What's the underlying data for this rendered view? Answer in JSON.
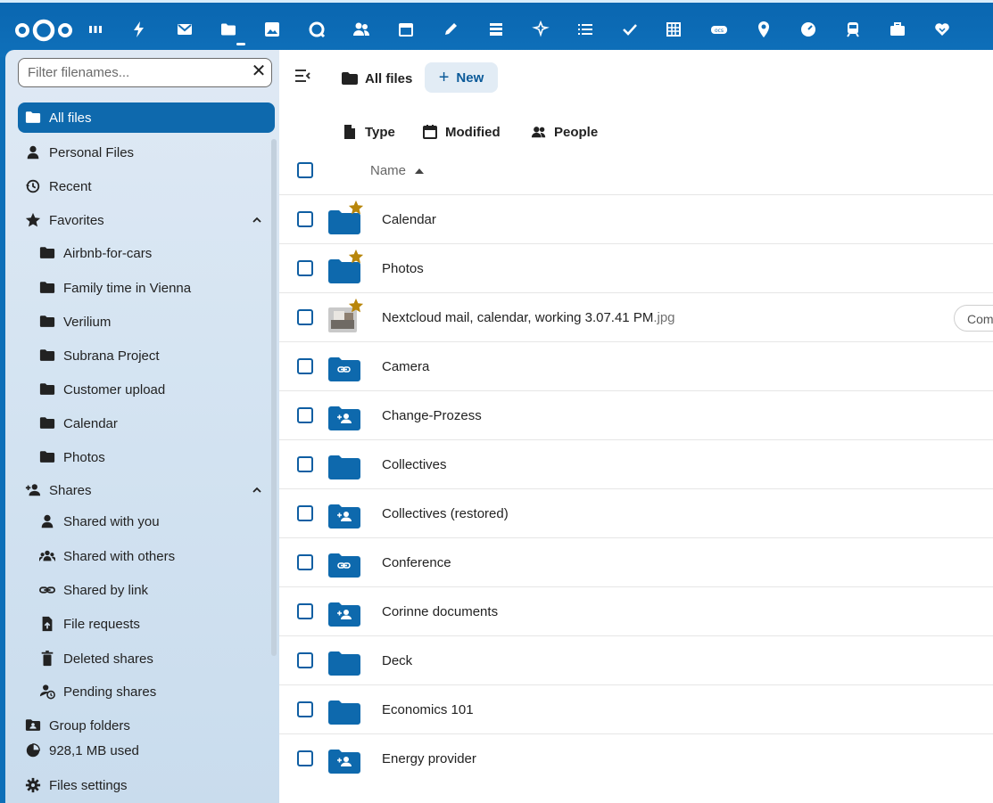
{
  "topbar": {
    "apps": [
      "dashboard-icon",
      "activity-icon",
      "mail-icon",
      "files-icon",
      "photos-icon",
      "talk-icon",
      "contacts-icon",
      "calendar-icon",
      "notes-icon",
      "deck-icon",
      "sparkle-icon",
      "tasks-list-icon",
      "checkmark-icon",
      "tables-icon",
      "ocs-icon",
      "maps-icon",
      "speedometer-icon",
      "train-icon",
      "briefcase-icon",
      "heart-hand-icon"
    ],
    "active_app": "files-icon"
  },
  "sidebar": {
    "filter_placeholder": "Filter filenames...",
    "clear": "✕",
    "items": [
      {
        "label": "All files",
        "icon": "folder-icon"
      },
      {
        "label": "Personal Files",
        "icon": "person-icon"
      },
      {
        "label": "Recent",
        "icon": "history-icon"
      },
      {
        "label": "Favorites",
        "icon": "star-icon"
      },
      {
        "label": "Airbnb-for-cars",
        "icon": "folder-icon"
      },
      {
        "label": "Family time in Vienna",
        "icon": "folder-icon"
      },
      {
        "label": "Verilium",
        "icon": "folder-icon"
      },
      {
        "label": "Subrana Project",
        "icon": "folder-icon"
      },
      {
        "label": "Customer upload",
        "icon": "folder-icon"
      },
      {
        "label": "Calendar",
        "icon": "folder-icon"
      },
      {
        "label": "Photos",
        "icon": "folder-icon"
      },
      {
        "label": "Shares",
        "icon": "share-add-icon"
      },
      {
        "label": "Shared with you",
        "icon": "person-icon"
      },
      {
        "label": "Shared with others",
        "icon": "group-icon"
      },
      {
        "label": "Shared by link",
        "icon": "link-icon"
      },
      {
        "label": "File requests",
        "icon": "file-upload-icon"
      },
      {
        "label": "Deleted shares",
        "icon": "trash-icon"
      },
      {
        "label": "Pending shares",
        "icon": "person-clock-icon"
      },
      {
        "label": "Group folders",
        "icon": "group-folder-icon"
      },
      {
        "label": "928,1 MB used",
        "icon": "pie-chart-icon"
      },
      {
        "label": "Files settings",
        "icon": "gear-icon"
      }
    ]
  },
  "main": {
    "breadcrumb": "All files",
    "new_label": "New",
    "filters": {
      "type": "Type",
      "modified": "Modified",
      "people": "People"
    },
    "name_header": "Name",
    "rows": [
      {
        "name": "Calendar",
        "ext": "",
        "kind": "folder",
        "fav": true
      },
      {
        "name": "Photos",
        "ext": "",
        "kind": "folder",
        "fav": true
      },
      {
        "name": "Nextcloud mail, calendar, working 3.07.41 PM",
        "ext": ".jpg",
        "kind": "image",
        "fav": true
      },
      {
        "name": "Camera",
        "ext": "",
        "kind": "link-folder",
        "fav": false
      },
      {
        "name": "Change-Prozess",
        "ext": "",
        "kind": "shared-folder",
        "fav": false
      },
      {
        "name": "Collectives",
        "ext": "",
        "kind": "folder",
        "fav": false
      },
      {
        "name": "Collectives (restored)",
        "ext": "",
        "kind": "shared-folder",
        "fav": false
      },
      {
        "name": "Conference",
        "ext": "",
        "kind": "link-folder",
        "fav": false
      },
      {
        "name": "Corinne documents",
        "ext": "",
        "kind": "shared-folder",
        "fav": false
      },
      {
        "name": "Deck",
        "ext": "",
        "kind": "folder",
        "fav": false
      },
      {
        "name": "Economics 101",
        "ext": "",
        "kind": "folder",
        "fav": false
      },
      {
        "name": "Energy provider",
        "ext": "",
        "kind": "shared-folder",
        "fav": false
      }
    ],
    "comment_pill": "Com"
  },
  "colors": {
    "brand": "#0e69ad",
    "folder": "#0e69ad",
    "star": "#b8860b"
  }
}
